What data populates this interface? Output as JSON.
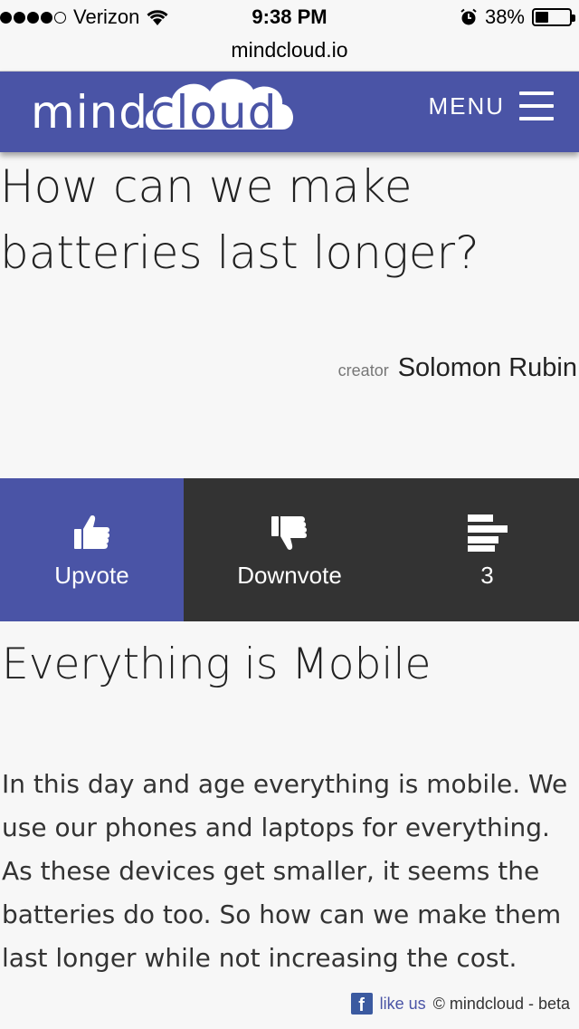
{
  "status_bar": {
    "carrier": "Verizon",
    "time": "9:38 PM",
    "battery_percent": "38%",
    "battery_level": 0.38,
    "signal_bars": 4,
    "icons": [
      "signal-dots-icon",
      "wifi-icon",
      "alarm-icon",
      "battery-icon"
    ]
  },
  "browser": {
    "url": "mindcloud.io"
  },
  "header": {
    "logo_part1": "mind",
    "logo_part2": "cloud",
    "menu_label": "MENU",
    "accent_color": "#4a54a6"
  },
  "question": {
    "title": "How can we make batteries last longer?",
    "creator_label": "creator",
    "creator_name": "Solomon Rubin"
  },
  "votes": {
    "upvote_label": "Upvote",
    "downvote_label": "Downvote",
    "count": "3",
    "upvote_bg": "#4a54a6",
    "dark_bg": "#333333"
  },
  "article": {
    "title": "Everything is Mobile",
    "body": "In this day and age everything is mobile. We use our phones and laptops for everything. As these devices get smaller, it seems the batteries do too. So how can we make them last longer while not increasing the cost."
  },
  "footer": {
    "fb_glyph": "f",
    "like_us": "like us",
    "copyright": "© mindcloud - beta"
  }
}
